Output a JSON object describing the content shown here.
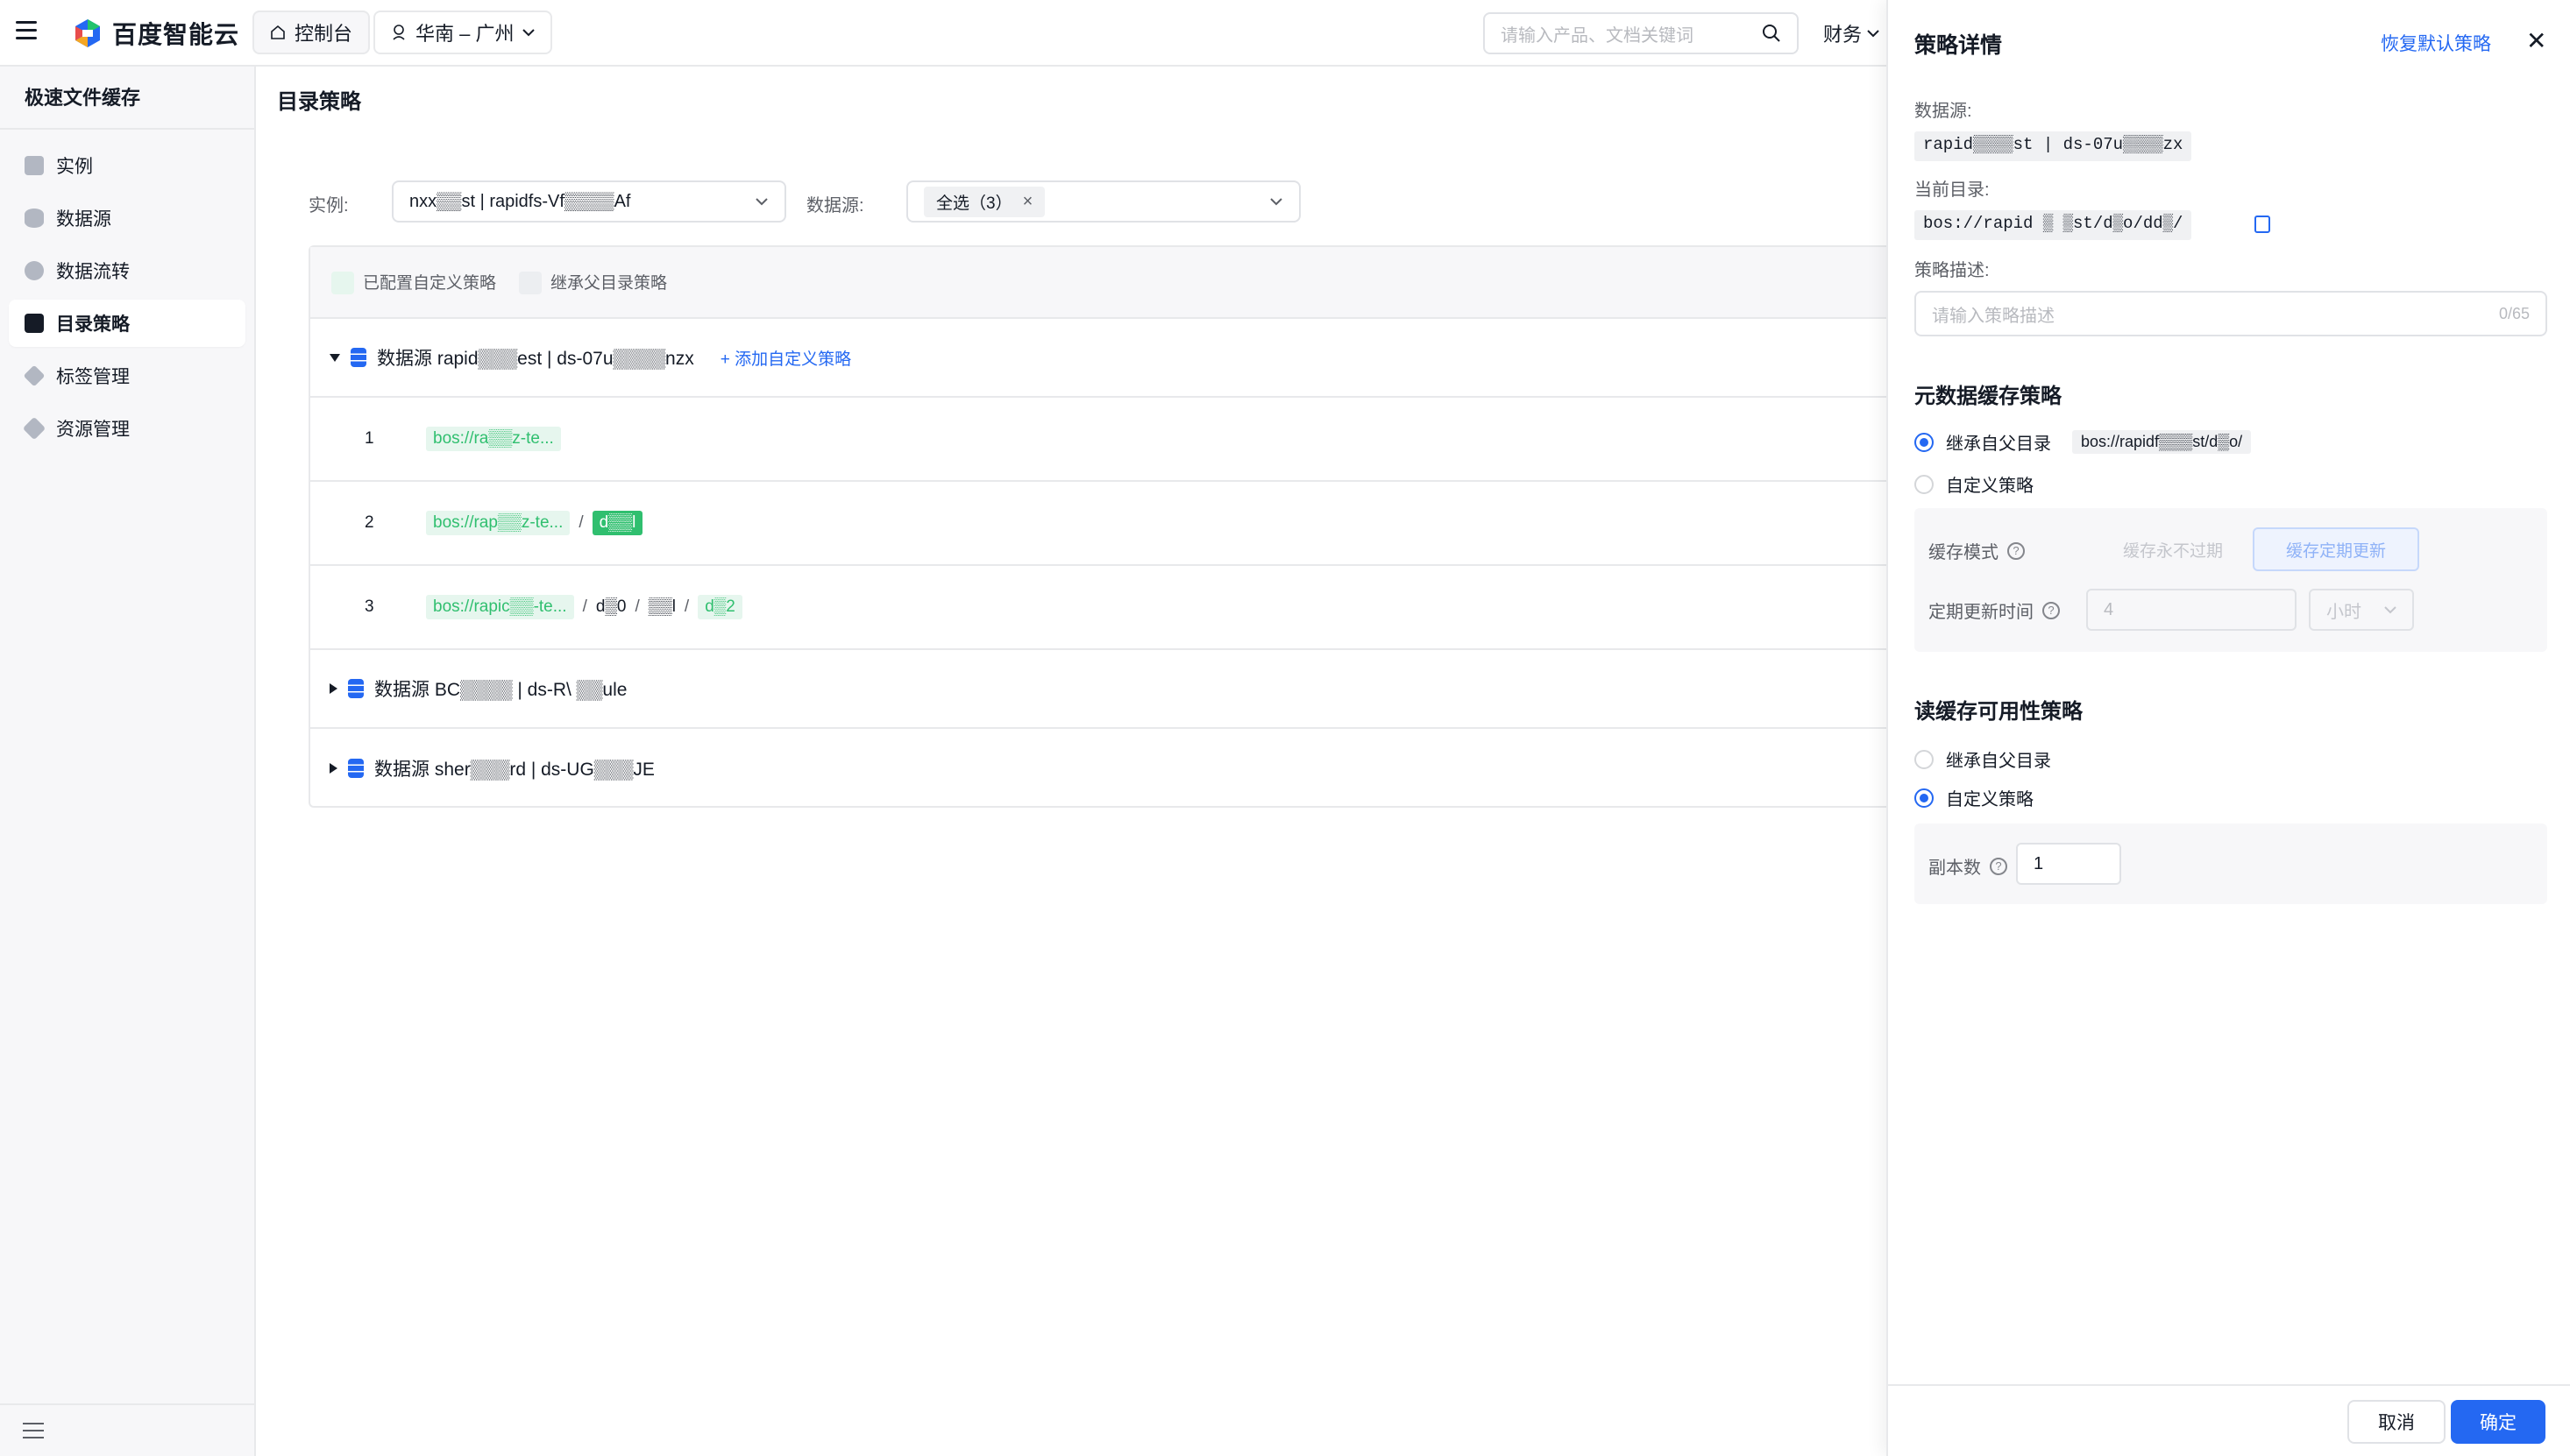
{
  "topbar": {
    "logo_text": "百度智能云",
    "console_label": "控制台",
    "region_label": "华南 – 广州",
    "search_placeholder": "请输入产品、文档关键词",
    "finance_label": "财务"
  },
  "sidebar": {
    "title": "极速文件缓存",
    "items": [
      {
        "label": "实例",
        "icon": "server-icon"
      },
      {
        "label": "数据源",
        "icon": "database-icon"
      },
      {
        "label": "数据流转",
        "icon": "flow-icon"
      },
      {
        "label": "目录策略",
        "icon": "directory-policy-icon",
        "active": true
      },
      {
        "label": "标签管理",
        "icon": "tag-icon"
      },
      {
        "label": "资源管理",
        "icon": "layers-icon"
      }
    ]
  },
  "main": {
    "title": "目录策略",
    "instance_label": "实例:",
    "instance_value": "nxx▒▒st | rapidfs-Vf▒▒▒▒Af",
    "datasource_label": "数据源:",
    "datasource_tag": "全选（3）",
    "legend": {
      "custom": "已配置自定义策略",
      "inherit": "继承父目录策略",
      "custom_color": "#e6f6ee",
      "inherit_color": "#eceef1"
    },
    "groups": [
      {
        "label": "数据源 rapid▒▒▒est | ds-07u▒▒▒▒nzx",
        "expanded": true,
        "add_link": "+ 添加自定义策略"
      },
      {
        "label": "数据源 BC▒▒▒▒ | ds-R\\ ▒▒ule",
        "expanded": false
      },
      {
        "label": "数据源 sher▒▒▒rd | ds-UG▒▒▒JE",
        "expanded": false
      }
    ],
    "paths": [
      {
        "index": "1",
        "segments": [
          "bos://ra▒▒z-te..."
        ]
      },
      {
        "index": "2",
        "segments": [
          "bos://rap▒▒z-te...",
          "/",
          "d▒▒l"
        ]
      },
      {
        "index": "3",
        "segments": [
          "bos://rapic▒▒-te...",
          "/",
          "d▒0",
          "/",
          "▒▒l",
          "/",
          "d▒2"
        ]
      }
    ]
  },
  "drawer": {
    "title": "策略详情",
    "restore_label": "恢复默认策略",
    "close_icon": "close-icon",
    "datasource_label": "数据源:",
    "datasource_value": "rapid▒▒▒▒st | ds-07u▒▒▒▒zx",
    "current_dir_label": "当前目录:",
    "current_dir_value": "bos://rapid ▒ ▒st/d▒o/dd▒/",
    "desc_label": "策略描述:",
    "desc_placeholder": "请输入策略描述",
    "desc_count": "0/65",
    "meta": {
      "title": "元数据缓存策略",
      "inherit_label": "继承自父目录",
      "inherit_path": "bos://rapidf▒▒▒st/d▒o/",
      "custom_label": "自定义策略",
      "selected": "inherit",
      "cache_mode_label": "缓存模式",
      "mode_never": "缓存永不过期",
      "mode_periodic": "缓存定期更新",
      "update_label": "定期更新时间",
      "update_value": "4",
      "unit_value": "小时"
    },
    "read": {
      "title": "读缓存可用性策略",
      "inherit_label": "继承自父目录",
      "custom_label": "自定义策略",
      "selected": "custom",
      "replica_label": "副本数",
      "replica_value": "1"
    },
    "cancel_label": "取消",
    "confirm_label": "确定"
  }
}
